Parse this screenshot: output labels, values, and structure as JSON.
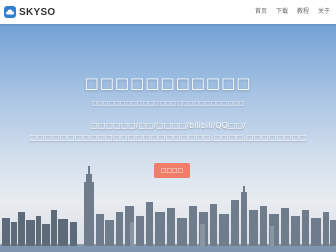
{
  "brand": {
    "name": "SKYSO",
    "accent": "#2f7fd2"
  },
  "nav": {
    "items": [
      "首页",
      "下载",
      "教程",
      "关于"
    ]
  },
  "hero": {
    "title": "□□□□□□□□□□□",
    "subtitle": "□□□□□□□□□□□□□□□□□□□□□□□□□□□",
    "description": "□□□□□□/□□/□□□□/bilibili/QQ□□/□□□□□□□□□□□□□□□□□□□□□□□□,□□□□,□□□□□□□□",
    "cta_label": "□□□□",
    "cta_color": "#f07c6a"
  }
}
